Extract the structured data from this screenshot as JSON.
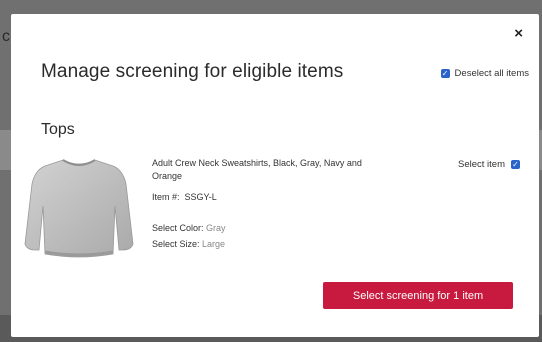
{
  "background": {
    "partial_letter": "c"
  },
  "modal": {
    "title": "Manage screening for eligible items",
    "close_label": "×",
    "deselect_all_label": "Deselect all items",
    "section_heading": "Tops",
    "item": {
      "name": "Adult Crew Neck Sweatshirts, Black, Gray, Navy and Orange",
      "item_number_label": "Item #:",
      "item_number": "SSGY-L",
      "color_label": "Select Color:",
      "color_value": "Gray",
      "size_label": "Select Size:",
      "size_value": "Large",
      "select_item_label": "Select item",
      "selected": true,
      "image_icon": "gray-sweatshirt-image"
    },
    "primary_button_label": "Select screening for 1 item"
  },
  "colors": {
    "accent": "#c8193f",
    "checkbox": "#2a63c9",
    "overlay": "#707070"
  }
}
